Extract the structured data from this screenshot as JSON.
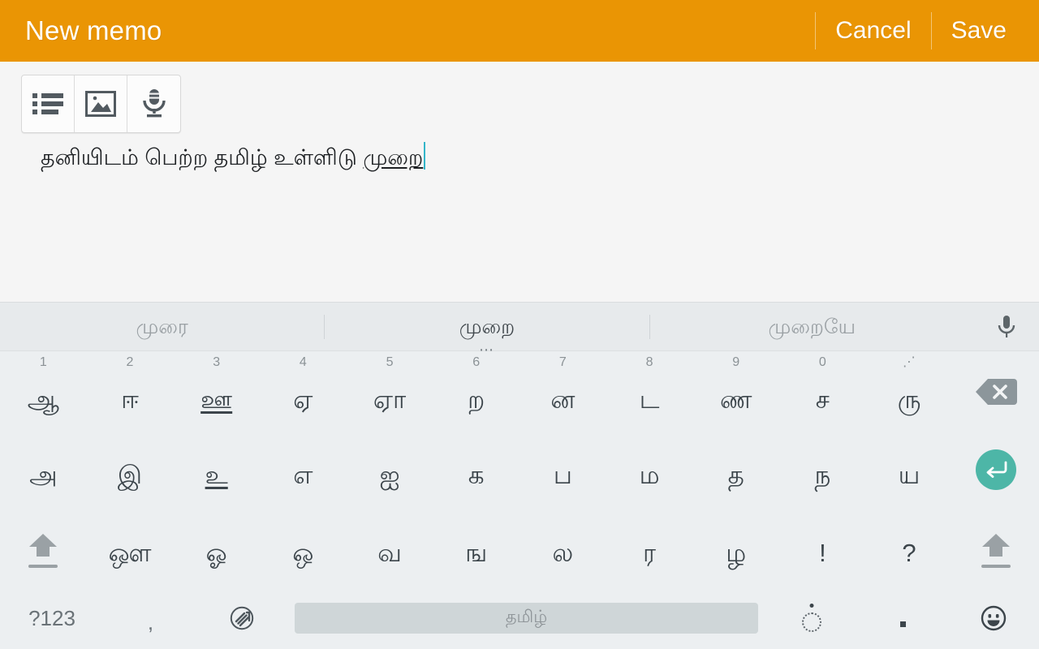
{
  "header": {
    "title": "New memo",
    "cancel_label": "Cancel",
    "save_label": "Save",
    "bg_color": "#ea9504",
    "text_color": "#ffffff"
  },
  "toolbar": {
    "buttons": [
      {
        "name": "checklist-icon",
        "label": "Checklist"
      },
      {
        "name": "image-icon",
        "label": "Insert image"
      },
      {
        "name": "voice-icon",
        "label": "Voice recording"
      }
    ]
  },
  "memo": {
    "committed_text": "தனியிடம் பெற்ற தமிழ் உள்ளிடு ",
    "composing_text": "முறை",
    "caret_color": "#33b5c9"
  },
  "keyboard": {
    "language": "தமிழ்",
    "space_label": "தமிழ்",
    "suggestions": [
      {
        "text": "முரை",
        "active": false
      },
      {
        "text": "முறை",
        "active": true,
        "dots": "⋯"
      },
      {
        "text": "முறையே",
        "active": false
      }
    ],
    "mic_icon": "microphone-icon",
    "rows": [
      {
        "id": "row-1",
        "keys": [
          {
            "glyph": "ஆ",
            "hint": "1",
            "underline": false
          },
          {
            "glyph": "ஈ",
            "hint": "2",
            "underline": false
          },
          {
            "glyph": "ஊ",
            "hint": "3",
            "underline": true
          },
          {
            "glyph": "ஏ",
            "hint": "4",
            "underline": false
          },
          {
            "glyph": "ஏா",
            "hint": "5",
            "underline": false
          },
          {
            "glyph": "ற",
            "hint": "6",
            "underline": false
          },
          {
            "glyph": "ன",
            "hint": "7",
            "underline": false
          },
          {
            "glyph": "ட",
            "hint": "8",
            "underline": false
          },
          {
            "glyph": "ண",
            "hint": "9",
            "underline": false
          },
          {
            "glyph": "ச",
            "hint": "0",
            "underline": false
          },
          {
            "glyph": "ரு",
            "hint": "⋰",
            "underline": false
          }
        ],
        "action": {
          "type": "backspace",
          "name": "backspace-key"
        }
      },
      {
        "id": "row-2",
        "keys": [
          {
            "glyph": "அ",
            "hint": "",
            "underline": false
          },
          {
            "glyph": "இ",
            "hint": "",
            "underline": false
          },
          {
            "glyph": "உ",
            "hint": "",
            "underline": true
          },
          {
            "glyph": "எ",
            "hint": "",
            "underline": false
          },
          {
            "glyph": "ஐ",
            "hint": "",
            "underline": false
          },
          {
            "glyph": "க",
            "hint": "",
            "underline": false
          },
          {
            "glyph": "ப",
            "hint": "",
            "underline": false
          },
          {
            "glyph": "ம",
            "hint": "",
            "underline": false
          },
          {
            "glyph": "த",
            "hint": "",
            "underline": false
          },
          {
            "glyph": "ந",
            "hint": "",
            "underline": false
          },
          {
            "glyph": "ய",
            "hint": "",
            "underline": false
          }
        ],
        "action": {
          "type": "enter",
          "name": "enter-key",
          "color": "#4db6a7"
        }
      },
      {
        "id": "row-3",
        "leading_action": {
          "type": "shift",
          "name": "shift-key-left"
        },
        "keys": [
          {
            "glyph": "ஔ",
            "hint": "",
            "underline": false
          },
          {
            "glyph": "ஓ",
            "hint": "",
            "underline": false
          },
          {
            "glyph": "ஒ",
            "hint": "",
            "underline": false
          },
          {
            "glyph": "வ",
            "hint": "",
            "underline": false
          },
          {
            "glyph": "ங",
            "hint": "",
            "underline": false
          },
          {
            "glyph": "ல",
            "hint": "",
            "underline": false
          },
          {
            "glyph": "ர",
            "hint": "",
            "underline": false
          },
          {
            "glyph": "ழ",
            "hint": "",
            "underline": false
          },
          {
            "glyph": "!",
            "hint": "",
            "underline": false
          },
          {
            "glyph": "?",
            "hint": "",
            "underline": false
          }
        ],
        "action": {
          "type": "shift",
          "name": "shift-key-right"
        }
      }
    ],
    "bottom_row": {
      "symbols_label": "?123",
      "comma_label": ",",
      "language_switch": "language-switch-icon",
      "space_label": "தமிழ்",
      "pulli_label": "ஂ",
      "period_label": ".",
      "emoji_label": "emoji-icon"
    }
  }
}
